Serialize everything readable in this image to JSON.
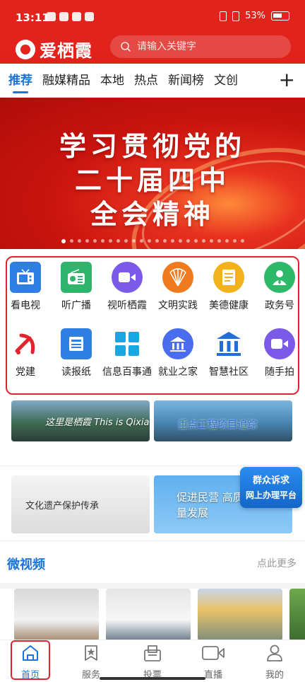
{
  "status": {
    "time": "13:11",
    "battery": "53%"
  },
  "header": {
    "app_name": "爱栖霞",
    "search_placeholder": "请输入关键字"
  },
  "tabs": [
    {
      "label": "推荐"
    },
    {
      "label": "融媒精品"
    },
    {
      "label": "本地"
    },
    {
      "label": "热点"
    },
    {
      "label": "新闻榜"
    },
    {
      "label": "文创"
    }
  ],
  "tab_add": "+",
  "banner": {
    "lines": [
      "学习贯彻党的",
      "二十届四中",
      "全会精神"
    ]
  },
  "grid": [
    {
      "label": "看电视",
      "icon": "tv-icon",
      "color": "#2f7fe3"
    },
    {
      "label": "听广播",
      "icon": "radio-icon",
      "color": "#2fb56b"
    },
    {
      "label": "视听栖霞",
      "icon": "video-icon",
      "color": "#7a5ae6"
    },
    {
      "label": "文明实践",
      "icon": "fan-icon",
      "color": "#f07a1e"
    },
    {
      "label": "美德健康",
      "icon": "notes-icon",
      "color": "#f3b21b"
    },
    {
      "label": "政务号",
      "icon": "user-icon",
      "color": "#2db86a"
    },
    {
      "label": "党建",
      "icon": "party-icon",
      "color": "#e0242d"
    },
    {
      "label": "读报纸",
      "icon": "newspaper-icon",
      "color": "#2f7fe3"
    },
    {
      "label": "信息百事通",
      "icon": "apps-icon",
      "color": "#1aa6e0"
    },
    {
      "label": "就业之家",
      "icon": "building-icon",
      "color": "#4a6df0"
    },
    {
      "label": "智慧社区",
      "icon": "institution-icon",
      "color": "#1f6fd6"
    },
    {
      "label": "随手拍",
      "icon": "camera-icon",
      "color": "#7a5ae6"
    }
  ],
  "promos": [
    {
      "text": "这里是栖霞 This is Qixia"
    },
    {
      "text": "重点工程项目追踪"
    },
    {
      "text": "文化遗产保护传承"
    },
    {
      "text": "促进民营 高质量发展"
    }
  ],
  "float_badge": {
    "line1": "群众诉求",
    "line2": "网上办理平台"
  },
  "micro_video": {
    "title": "微视频",
    "more": "点此更多"
  },
  "bottom_nav": [
    {
      "label": "首页",
      "icon": "home-icon"
    },
    {
      "label": "服务",
      "icon": "star-book-icon"
    },
    {
      "label": "投票",
      "icon": "ballot-box-icon"
    },
    {
      "label": "直播",
      "icon": "live-camera-icon"
    },
    {
      "label": "我的",
      "icon": "profile-icon"
    }
  ]
}
